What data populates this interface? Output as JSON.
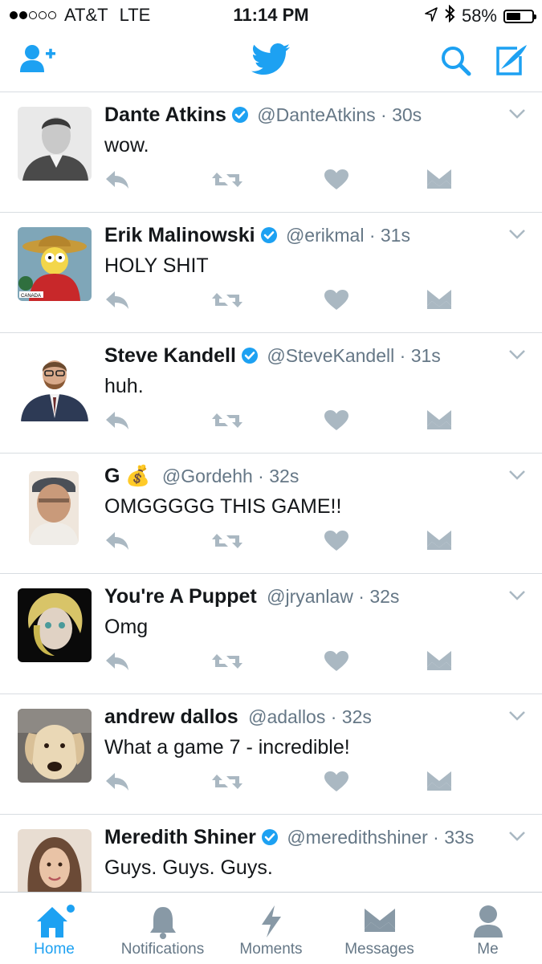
{
  "status_bar": {
    "carrier": "AT&T",
    "network": "LTE",
    "time": "11:14 PM",
    "battery": "58%",
    "battery_level": 0.58,
    "signal_bars": 2
  },
  "nav_bar": {
    "left_icon": "add-user-icon",
    "center_icon": "twitter-bird-icon",
    "right_icons": [
      "search-icon",
      "compose-icon"
    ]
  },
  "colors": {
    "accent": "#1da1f2",
    "secondary_text": "#657786",
    "action_icon": "#aab8c2",
    "divider": "#d8dde1"
  },
  "tweets": [
    {
      "name": "Dante Atkins",
      "verified": true,
      "handle": "@DanteAtkins",
      "time": "30s",
      "text": "wow."
    },
    {
      "name": "Erik Malinowski",
      "verified": true,
      "handle": "@erikmal",
      "time": "31s",
      "text": "HOLY SHIT"
    },
    {
      "name": "Steve Kandell",
      "verified": true,
      "handle": "@SteveKandell",
      "time": "31s",
      "text": "huh."
    },
    {
      "name": "G 💰",
      "verified": false,
      "handle": "@Gordehh",
      "time": "32s",
      "text": "OMGGGGG THIS GAME!!"
    },
    {
      "name": "You're A Puppet",
      "verified": false,
      "handle": "@jryanlaw",
      "time": "32s",
      "text": "Omg"
    },
    {
      "name": "andrew dallos",
      "verified": false,
      "handle": "@adallos",
      "time": "32s",
      "text": "What a game 7 - incredible!"
    },
    {
      "name": "Meredith Shiner",
      "verified": true,
      "handle": "@meredithshiner",
      "time": "33s",
      "text": "Guys. Guys. Guys."
    }
  ],
  "tab_bar": {
    "tabs": [
      {
        "label": "Home",
        "icon": "home-icon",
        "active": true
      },
      {
        "label": "Notifications",
        "icon": "bell-icon",
        "active": false
      },
      {
        "label": "Moments",
        "icon": "lightning-icon",
        "active": false
      },
      {
        "label": "Messages",
        "icon": "envelope-icon",
        "active": false
      },
      {
        "label": "Me",
        "icon": "person-icon",
        "active": false
      }
    ]
  }
}
